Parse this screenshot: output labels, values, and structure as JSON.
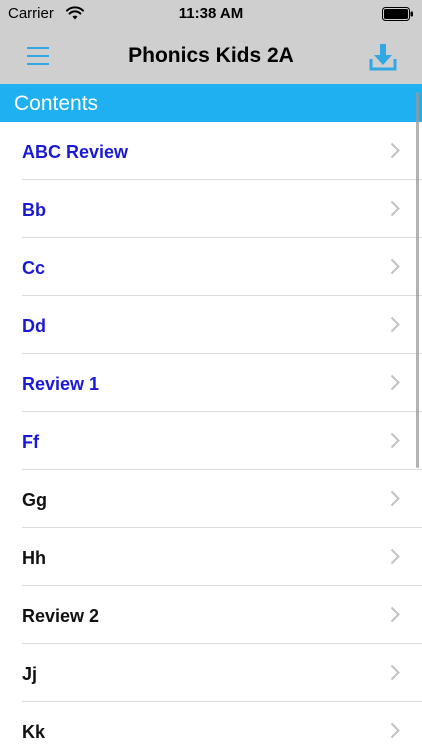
{
  "status_bar": {
    "carrier": "Carrier",
    "time": "11:38 AM",
    "icons": [
      "wifi-icon",
      "battery-icon"
    ]
  },
  "nav_bar": {
    "title": "Phonics Kids 2A",
    "left_icon": "menu-icon",
    "right_icon": "download-icon"
  },
  "section": {
    "title": "Contents"
  },
  "list": {
    "items": [
      {
        "label": "ABC Review",
        "color": "#1a1ad6"
      },
      {
        "label": "Bb",
        "color": "#1a1ad6"
      },
      {
        "label": "Cc",
        "color": "#1a1ad6"
      },
      {
        "label": "Dd",
        "color": "#1a1ad6"
      },
      {
        "label": "Review 1",
        "color": "#1a1ad6"
      },
      {
        "label": "Ff",
        "color": "#1a1ad6"
      },
      {
        "label": "Gg",
        "color": "#111111"
      },
      {
        "label": "Hh",
        "color": "#111111"
      },
      {
        "label": "Review 2",
        "color": "#111111"
      },
      {
        "label": "Jj",
        "color": "#111111"
      },
      {
        "label": "Kk",
        "color": "#111111"
      }
    ]
  },
  "colors": {
    "bar_gray": "#cfcfcf",
    "accent_blue": "#1fb0f2",
    "link_blue": "#1a1ad6",
    "text_black": "#111111",
    "divider": "#dcdcdc"
  }
}
